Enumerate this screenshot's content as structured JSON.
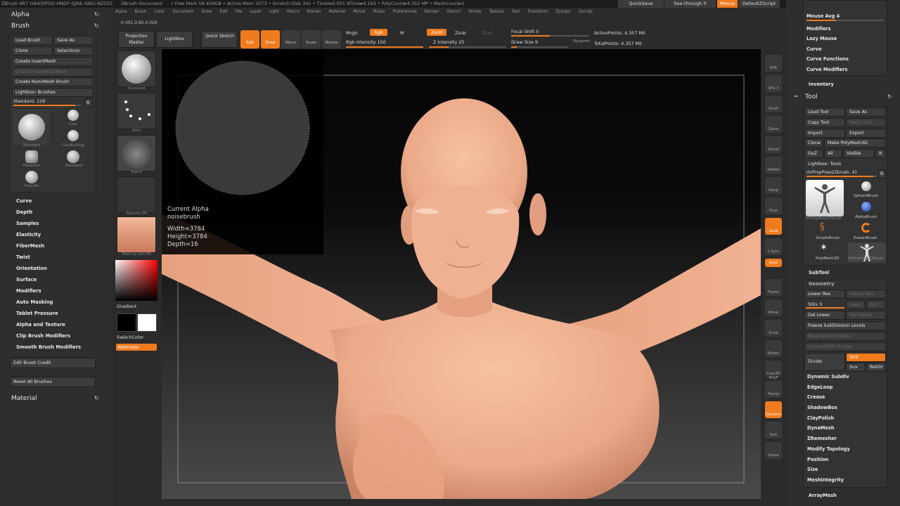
{
  "titlebar": {
    "app": "ZBrush 4R7 (x64)[IPOO-HNDF-QJNE-GBCI-NZCG]",
    "doc": "ZBrush Document",
    "stats": "• Free Mem 58.459GB • Active Mem 1073 • Scratch Disk 341 • Timer▸0.001 ATime▸9.163 • PolyCount▸4.352 MP • MeshCount▸1",
    "quicksave": "QuickSave",
    "seethrough": "See-through 0",
    "menus": "Menus",
    "script": "DefaultZScript"
  },
  "menubar": [
    "Alpha",
    "Brush",
    "Color",
    "Document",
    "Draw",
    "Edit",
    "File",
    "Layer",
    "Light",
    "Macro",
    "Marker",
    "Material",
    "Movie",
    "Picker",
    "Preferences",
    "Render",
    "Stencil",
    "Stroke",
    "Texture",
    "Tool",
    "Transform",
    "Zplugin",
    "Zscript"
  ],
  "coords": "-0.491,0.82,0.029",
  "left": {
    "alpha_header": "Alpha",
    "brush_header": "Brush",
    "buttons": {
      "load_brush": "Load Brush",
      "save_as": "Save As",
      "clone": "Clone",
      "select_icon": "SelectIcon",
      "create_insertmesh": "Create InsertMesh",
      "create_insertmultimesh": "Create InsertMultiMesh",
      "create_nanomesh": "Create NanoMesh Brush",
      "lightbox_brushes": "Lightbox› Brushes"
    },
    "brush_slider": "Standard. 126",
    "r_label": "R",
    "brushes": [
      {
        "name": "Standard"
      },
      {
        "name": "Clay"
      },
      {
        "name": "ClayBuildup"
      },
      {
        "name": "MaskPen"
      },
      {
        "name": "Standard"
      },
      {
        "name": "Smooth"
      }
    ],
    "menu": [
      "Curve",
      "Depth",
      "Samples",
      "Elasticity",
      "FiberMesh",
      "Twist",
      "Orientation",
      "Surface",
      "Modifiers",
      "Auto Masking",
      "Tablet Pressure",
      "Alpha and Texture",
      "Clip Brush Modifiers",
      "Smooth Brush Modifiers"
    ],
    "edit_credit": "Edit Brush Credit",
    "reset_all": "Reset All Brushes",
    "material_header": "Material"
  },
  "shelf": {
    "projection_master": "Projection Master",
    "lightbox": "LightBox",
    "quick_sketch": "Quick Sketch",
    "edit": "Edit",
    "draw": "Draw",
    "move": "Move",
    "scale": "Scale",
    "rotate": "Rotate",
    "mrgb": "Mrgb",
    "rgb": "Rgb",
    "m": "M",
    "rgb_intensity": "Rgb Intensity 100",
    "zadd": "Zadd",
    "zsub": "Zsub",
    "zcut": "Zcut",
    "z_intensity": "Z Intensity 25",
    "focal_shift": "Focal Shift 0",
    "draw_size": "Draw Size 9",
    "dynamic": "Dynamic",
    "active_points": "ActivePoints: 4.357 Mil",
    "total_points": "TotalPoints: 4.357 Mil"
  },
  "thumbs": {
    "labels": [
      "Standard",
      "Dots",
      "Alpha",
      "Texture Off",
      "MatCap Skin06"
    ],
    "gradient": "Gradient",
    "switch_color": "SwitchColor",
    "alternate": "Alternate"
  },
  "popup": {
    "title": "Current Alpha",
    "name": "noisebrush",
    "width": "Width=3784",
    "height": "Height=3784",
    "depth": "Depth=16"
  },
  "right_shelf": [
    "BPR",
    "SPix 3",
    "Scroll",
    "Zoom",
    "Actual",
    "AAHalf",
    "Persp",
    "Floor",
    "Local",
    "L.Sym",
    "Gxyz",
    "Frame",
    "Move",
    "Scale",
    "Rotate",
    "Line Fill PolyF",
    "Transp",
    "Dynamic",
    "Solo",
    "Xpose"
  ],
  "right": {
    "top_items": [
      "Mouse Avg 4",
      "Modifiers",
      "Lazy Mouse",
      "Curve",
      "Curve Functions",
      "Curve Modifiers"
    ],
    "inventory": "Inventory",
    "tool_header": "Tool",
    "buttons": {
      "load_tool": "Load Tool",
      "save_as": "Save As",
      "copy_tool": "Copy Tool",
      "paste_tool": "Paste Tool",
      "import": "Import",
      "export": "Export",
      "clone": "Clone",
      "make_polymesh": "Make PolyMesh3D",
      "goz": "GoZ",
      "all": "All",
      "visible": "Visible",
      "r": "R",
      "lightbox_tools": "Lightbox› Tools"
    },
    "tool_slider": "UVPrepPose2Zbrush. 41",
    "tools": [
      {
        "name": "UVPrepPose2Zbrush"
      },
      {
        "name": "SphereBrush"
      },
      {
        "name": "AlphaBrush"
      },
      {
        "name": "SimpleBrush"
      },
      {
        "name": "EraserBrush"
      },
      {
        "name": "PolyMesh3D"
      },
      {
        "name": "UVPrepPose2Zbrush"
      }
    ],
    "subtool": "SubTool",
    "geometry": "Geometry",
    "lower_res": "Lower Res",
    "higher_res": "Higher Res",
    "sdiv": "SDiv 5",
    "cage": "Cage",
    "rstr": "Rstr",
    "del_lower": "Del Lower",
    "del_higher": "Del Higher",
    "freeze": "Freeze SubDivision Levels",
    "reconstruct": "Reconstruct Subdiv",
    "convert_bpr": "Convert BPR To Geo",
    "divide": "Divide",
    "smt": "Smt",
    "suv": "Suv",
    "reluv": "RelUV",
    "menu": [
      "Dynamic Subdiv",
      "EdgeLoop",
      "Crease",
      "ShadowBox",
      "ClayPolish",
      "DynaMesh",
      "ZRemesher",
      "Modify Topology",
      "Position",
      "Size",
      "MeshIntegrity"
    ],
    "arraymesh": "ArrayMesh"
  },
  "colors": {
    "accent": "#f07b1e",
    "panel": "#2e2e2e",
    "skin": "#eba989"
  }
}
